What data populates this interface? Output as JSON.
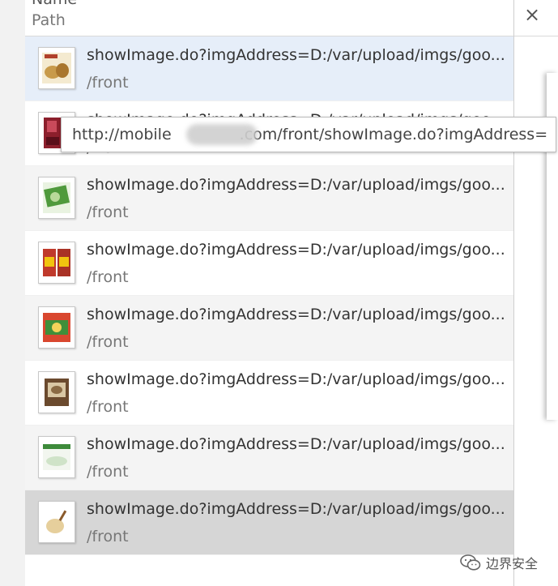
{
  "header": {
    "name_label": "Name",
    "path_label": "Path"
  },
  "close_glyph": "×",
  "rows": [
    {
      "name": "showImage.do?imgAddress=D:/var/upload/imgs/goo...",
      "path": "/front",
      "thumb": "thumb-food-icon"
    },
    {
      "name": "showImage.do?imgAddress=D:/var/upload/imgs/goo...",
      "path": "/front",
      "thumb": "thumb-bag-icon"
    },
    {
      "name": "showImage.do?imgAddress=D:/var/upload/imgs/goo...",
      "path": "/front",
      "thumb": "thumb-green-pack-icon"
    },
    {
      "name": "showImage.do?imgAddress=D:/var/upload/imgs/goo...",
      "path": "/front",
      "thumb": "thumb-red-box-icon"
    },
    {
      "name": "showImage.do?imgAddress=D:/var/upload/imgs/goo...",
      "path": "/front",
      "thumb": "thumb-red-green-pack-icon"
    },
    {
      "name": "showImage.do?imgAddress=D:/var/upload/imgs/goo...",
      "path": "/front",
      "thumb": "thumb-brown-box-icon"
    },
    {
      "name": "showImage.do?imgAddress=D:/var/upload/imgs/goo...",
      "path": "/front",
      "thumb": "thumb-white-pack-icon"
    },
    {
      "name": "showImage.do?imgAddress=D:/var/upload/imgs/goo...",
      "path": "/front",
      "thumb": "thumb-tea-icon"
    }
  ],
  "tooltip": {
    "prefix": "http://mobile",
    "suffix": ".com/front/showImage.do?imgAddress="
  },
  "watermark": {
    "text": "边界安全"
  },
  "colors": {
    "hover_row": "#e6eef9",
    "selected_row": "#d6d6d6",
    "alt_row": "#f4f4f4"
  }
}
